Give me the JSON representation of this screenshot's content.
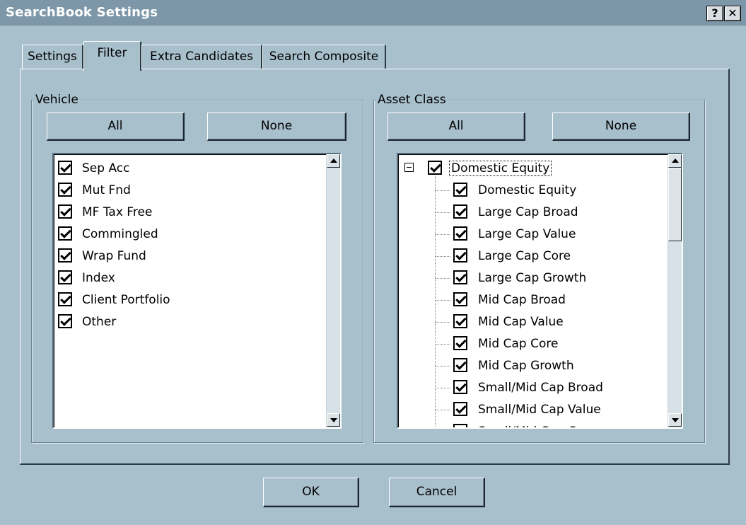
{
  "window": {
    "title": "SearchBook Settings",
    "help_glyph": "?",
    "close_glyph": "✕"
  },
  "tabs": [
    {
      "label": "Settings"
    },
    {
      "label": "Filter",
      "active": true
    },
    {
      "label": "Extra Candidates"
    },
    {
      "label": "Search Composite"
    }
  ],
  "vehicle": {
    "label": "Vehicle",
    "all_label": "All",
    "none_label": "None",
    "items": [
      {
        "label": "Sep Acc",
        "checked": true
      },
      {
        "label": "Mut Fnd",
        "checked": true
      },
      {
        "label": "MF Tax Free",
        "checked": true
      },
      {
        "label": "Commingled",
        "checked": true
      },
      {
        "label": "Wrap Fund",
        "checked": true
      },
      {
        "label": "Index",
        "checked": true
      },
      {
        "label": "Client Portfolio",
        "checked": true
      },
      {
        "label": "Other",
        "checked": true
      }
    ]
  },
  "asset_class": {
    "label": "Asset Class",
    "all_label": "All",
    "none_label": "None",
    "root": {
      "label": "Domestic Equity",
      "checked": true,
      "expanded": true
    },
    "children": [
      {
        "label": "Domestic Equity",
        "checked": true
      },
      {
        "label": "Large Cap Broad",
        "checked": true
      },
      {
        "label": "Large Cap Value",
        "checked": true
      },
      {
        "label": "Large Cap Core",
        "checked": true
      },
      {
        "label": "Large Cap Growth",
        "checked": true
      },
      {
        "label": "Mid Cap Broad",
        "checked": true
      },
      {
        "label": "Mid Cap Value",
        "checked": true
      },
      {
        "label": "Mid Cap Core",
        "checked": true
      },
      {
        "label": "Mid Cap Growth",
        "checked": true
      },
      {
        "label": "Small/Mid Cap Broad",
        "checked": true
      },
      {
        "label": "Small/Mid Cap Value",
        "checked": true
      },
      {
        "label": "Small/Mid Cap Core",
        "checked": true
      }
    ]
  },
  "footer": {
    "ok_label": "OK",
    "cancel_label": "Cancel"
  },
  "colors": {
    "dialog_background": "#a8bfcc",
    "title_bar": "#7d97a8",
    "list_background": "#ffffff"
  }
}
